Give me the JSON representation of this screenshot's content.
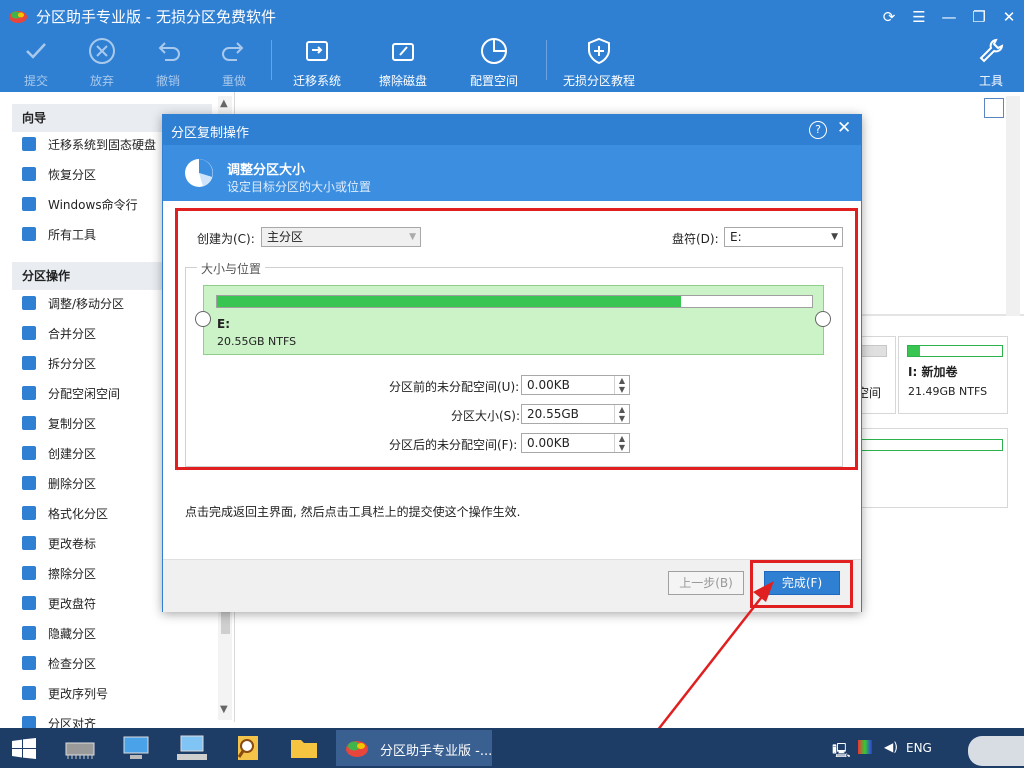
{
  "window": {
    "title": "分区助手专业版 - 无损分区免费软件"
  },
  "toolbar": {
    "commit": "提交",
    "discard": "放弃",
    "undo": "撤销",
    "redo": "重做",
    "migrate": "迁移系统",
    "wipe": "擦除磁盘",
    "allocate": "配置空间",
    "tutorial": "无损分区教程",
    "tools": "工具"
  },
  "sidebar": {
    "wizard_header": "向导",
    "wizard_items": [
      "迁移系统到固态硬盘",
      "恢复分区",
      "Windows命令行",
      "所有工具"
    ],
    "ops_header": "分区操作",
    "ops_items": [
      "调整/移动分区",
      "合并分区",
      "拆分分区",
      "分配空闲空间",
      "复制分区",
      "创建分区",
      "删除分区",
      "格式化分区",
      "更改卷标",
      "擦除分区",
      "更改盘符",
      "隐藏分区",
      "检查分区",
      "更改序列号",
      "分区对齐"
    ]
  },
  "background": {
    "volume_name": "I: 新加卷",
    "volume_size": "21.49GB NTFS",
    "partial_label": "空间"
  },
  "dialog": {
    "title": "分区复制操作",
    "header_title": "调整分区大小",
    "header_subtitle": "设定目标分区的大小或位置",
    "create_as_label": "创建为(C):",
    "create_as_value": "主分区",
    "drive_letter_label": "盘符(D):",
    "drive_letter_value": "E:",
    "group_label": "大小与位置",
    "partition_name": "E:",
    "partition_info": "20.55GB NTFS",
    "partition_fill_fraction": 0.78,
    "before_label": "分区前的未分配空间(U):",
    "before_value": "0.00KB",
    "size_label": "分区大小(S):",
    "size_value": "20.55GB",
    "after_label": "分区后的未分配空间(F):",
    "after_value": "0.00KB",
    "hint": "点击完成返回主界面, 然后点击工具栏上的提交使这个操作生效.",
    "back_button": "上一步(B)",
    "finish_button": "完成(F)"
  },
  "taskbar": {
    "active_app": "分区助手专业版 -...",
    "lang": "ENG"
  },
  "colors": {
    "accent": "#2f7fd3",
    "partition_green": "#38c552",
    "highlight_red": "#e02020"
  }
}
